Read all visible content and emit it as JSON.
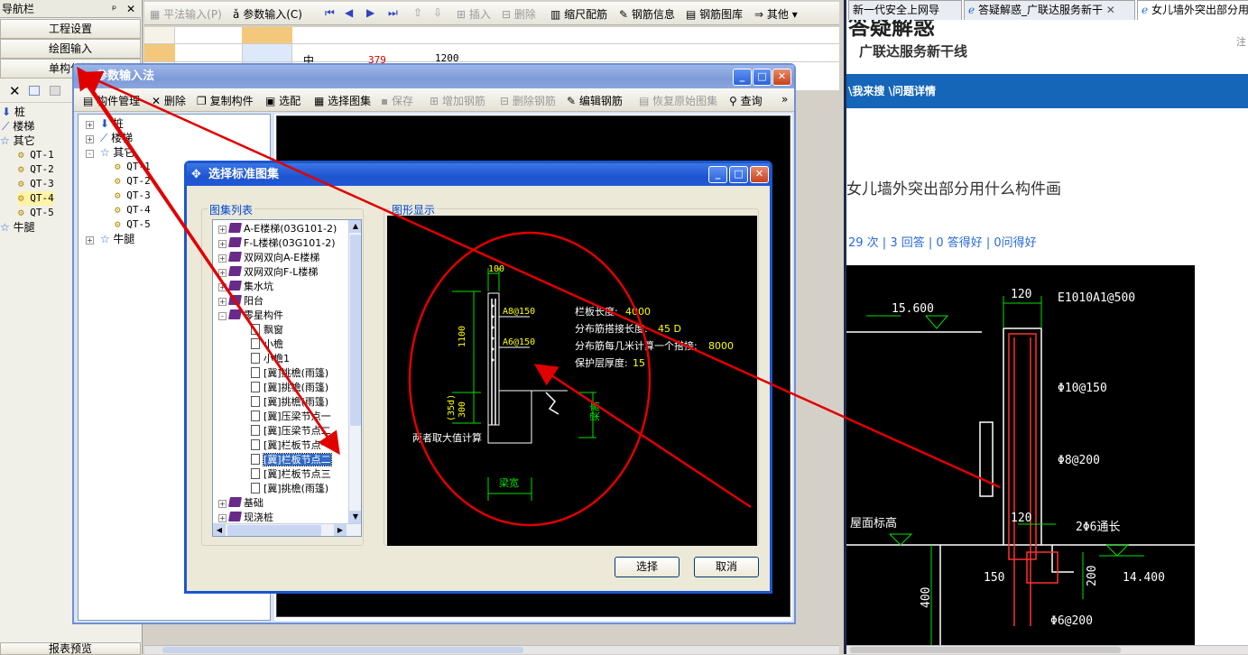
{
  "nav": {
    "title": "导航栏",
    "pin": "ᵖ",
    "close": "✕",
    "btn_project": "工程设置",
    "btn_draw": "绘图输入",
    "btn_single": "单构件输",
    "btn_report": "报表预览",
    "tree": [
      {
        "label": "桩"
      },
      {
        "label": "楼梯"
      },
      {
        "label": "其它"
      },
      {
        "label": "QT-1"
      },
      {
        "label": "QT-2"
      },
      {
        "label": "QT-3"
      },
      {
        "label": "QT-4"
      },
      {
        "label": "QT-5"
      },
      {
        "label": "牛腿"
      }
    ]
  },
  "main_toolbar": {
    "formula": "平法输入(P)",
    "param": "参数输入(C)",
    "insert": "插入",
    "delete": "删除",
    "scale": "缩尺配筋",
    "rebar_info": "钢筋信息",
    "rebar_lib": "钢筋图库",
    "other": "其他"
  },
  "grid": {
    "cell_mid": "中",
    "val1": "379",
    "val2": "1200"
  },
  "param_window": {
    "title": "参数输入法",
    "toolbar": {
      "manage": "构件管理",
      "delete": "删除",
      "copy": "复制构件",
      "select": "选配",
      "choose_atlas": "选择图集",
      "save": "保存",
      "add_rebar": "增加钢筋",
      "del_rebar": "删除钢筋",
      "edit_rebar": "编辑钢筋",
      "restore": "恢复原始图集",
      "query": "查询",
      "more": "»"
    },
    "tree": [
      {
        "label": "桩"
      },
      {
        "label": "楼梯"
      },
      {
        "label": "其它"
      },
      {
        "label": "QT-1"
      },
      {
        "label": "QT-2"
      },
      {
        "label": "QT-3"
      },
      {
        "label": "QT-4"
      },
      {
        "label": "QT-5"
      },
      {
        "label": "牛腿"
      }
    ]
  },
  "select_dialog": {
    "title": "选择标准图集",
    "list_label": "图集列表",
    "display_label": "图形显示",
    "items": [
      {
        "label": "A-E楼梯(03G101-2)",
        "kind": "book",
        "exp": "+"
      },
      {
        "label": "F-L楼梯(03G101-2)",
        "kind": "book",
        "exp": "+"
      },
      {
        "label": "双网双向A-E楼梯",
        "kind": "book",
        "exp": "+"
      },
      {
        "label": "双网双向F-L楼梯",
        "kind": "book",
        "exp": "+"
      },
      {
        "label": "集水坑",
        "kind": "book",
        "exp": "+"
      },
      {
        "label": "阳台",
        "kind": "book",
        "exp": "+"
      },
      {
        "label": "零星构件",
        "kind": "book",
        "exp": "-"
      },
      {
        "label": "飘窗",
        "kind": "doc"
      },
      {
        "label": "小檐",
        "kind": "doc"
      },
      {
        "label": "小檐1",
        "kind": "doc"
      },
      {
        "label": "[冀]挑檐(雨篷)",
        "kind": "doc"
      },
      {
        "label": "[冀]挑檐(雨篷)",
        "kind": "doc"
      },
      {
        "label": "[冀]挑檐(雨篷)",
        "kind": "doc"
      },
      {
        "label": "[冀]压梁节点一",
        "kind": "doc"
      },
      {
        "label": "[冀]压梁节点二",
        "kind": "doc"
      },
      {
        "label": "[冀]栏板节点一",
        "kind": "doc"
      },
      {
        "label": "[冀]栏板节点二",
        "kind": "doc",
        "selected": true
      },
      {
        "label": "[冀]栏板节点三",
        "kind": "doc"
      },
      {
        "label": "[冀]挑檐(雨篷)",
        "kind": "doc"
      },
      {
        "label": "基础",
        "kind": "book",
        "exp": "+"
      },
      {
        "label": "现浇桩",
        "kind": "book",
        "exp": "+"
      }
    ],
    "drawing": {
      "dim_top": "100",
      "dim_left1": "1100",
      "dim_left2": "300",
      "dim_left3": "(35d)",
      "rebar1": "A8@150",
      "rebar2": "A6@150",
      "note_left": "两者取大值计算",
      "beam_height": "梁高",
      "beam_width": "梁宽",
      "p1_label": "栏板长度:",
      "p1_value": "4000",
      "p2_label": "分布筋搭接长度:",
      "p2_value": "45 D",
      "p3_label": "分布筋每几米计算一个搭接:",
      "p3_value": "8000",
      "p4_label": "保护层厚度:",
      "p4_value": "15"
    },
    "btn_select": "选择",
    "btn_cancel": "取消"
  },
  "browser": {
    "tab1": "新一代安全上网导",
    "tab2": "答疑解惑_广联达服务新干",
    "tab3": "女儿墙外突出部分用",
    "heading": "答疑解惑",
    "subheading": "广联达服务新干线",
    "breadcrumb": "\\我来搜 \\问题详情",
    "question": "女儿墙外突出部分用什么构件画",
    "stats": "29 次 | 3 回答 | 0 答得好 | 0问得好",
    "side_char": "注",
    "cad": {
      "elev1": "15.600",
      "elev2": "14.400",
      "w1": "120",
      "r1": "E1010A1@500",
      "r2": "Φ10@150",
      "r3": "Φ8@200",
      "w2": "120",
      "r4": "2Φ6通长",
      "d1": "150",
      "d2": "200",
      "d3": "400",
      "r5": "Φ6@200",
      "floor": "屋面标高"
    }
  }
}
